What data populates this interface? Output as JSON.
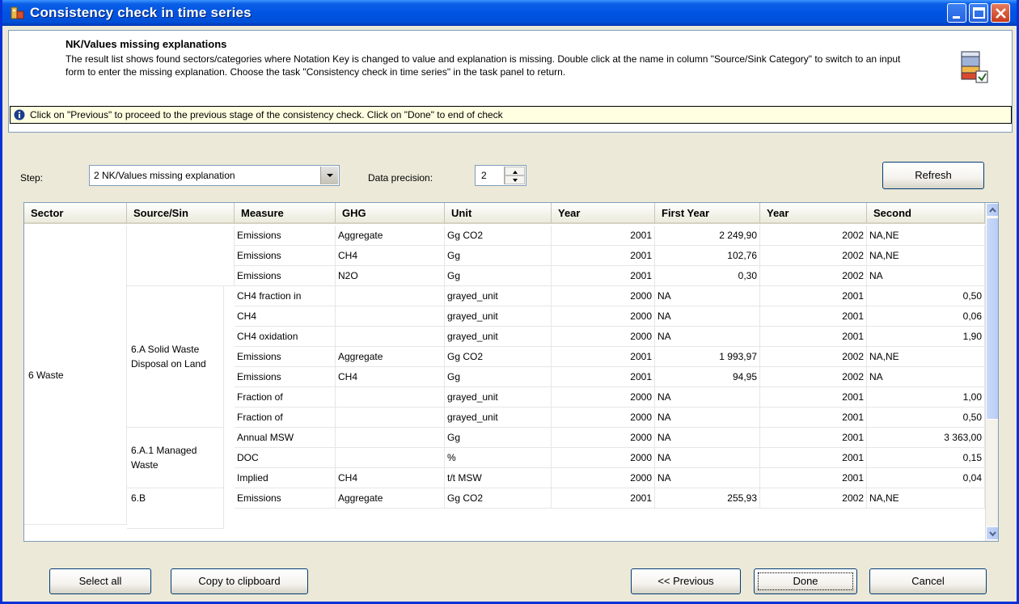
{
  "window": {
    "title": "Consistency check in time series"
  },
  "header": {
    "title": "NK/Values missing explanations",
    "description": "The result list shows found sectors/categories where Notation Key is changed to value and explanation is missing. Double click at the name in column \"Source/Sink Category\" to switch to an input form to enter the missing explanation. Choose the task \"Consistency check in time series\" in the task panel to return."
  },
  "info": {
    "text": "Click on \"Previous\" to proceed to the previous stage of the consistency check. Click on \"Done\" to end of check"
  },
  "toolbar": {
    "step_label": "Step:",
    "step_value": "2  NK/Values missing explanation",
    "precision_label": "Data precision:",
    "precision_value": "2",
    "refresh_label": "Refresh"
  },
  "grid": {
    "columns": [
      "Sector",
      "Source/Sin",
      "Measure",
      "GHG",
      "Unit",
      "Year",
      "First Year",
      "Year",
      "Second"
    ],
    "sector_cell": "6 Waste",
    "source_groups": [
      "6.A Solid Waste Disposal on Land",
      "6.A.1 Managed Waste",
      "6.B"
    ],
    "rows": [
      [
        "Emissions",
        "Aggregate",
        "Gg CO2",
        "2001",
        "2 249,90",
        "2002",
        "NA,NE"
      ],
      [
        "Emissions",
        "CH4",
        "Gg",
        "2001",
        "102,76",
        "2002",
        "NA,NE"
      ],
      [
        "Emissions",
        "N2O",
        "Gg",
        "2001",
        "0,30",
        "2002",
        "NA"
      ],
      [
        "CH4 fraction in",
        "",
        "grayed_unit",
        "2000",
        "NA",
        "2001",
        "0,50"
      ],
      [
        "CH4",
        "",
        "grayed_unit",
        "2000",
        "NA",
        "2001",
        "0,06"
      ],
      [
        "CH4 oxidation",
        "",
        "grayed_unit",
        "2000",
        "NA",
        "2001",
        "1,90"
      ],
      [
        "Emissions",
        "Aggregate",
        "Gg CO2",
        "2001",
        "1 993,97",
        "2002",
        "NA,NE"
      ],
      [
        "Emissions",
        "CH4",
        "Gg",
        "2001",
        "94,95",
        "2002",
        "NA"
      ],
      [
        "Fraction of",
        "",
        "grayed_unit",
        "2000",
        "NA",
        "2001",
        "1,00"
      ],
      [
        "Fraction of",
        "",
        "grayed_unit",
        "2000",
        "NA",
        "2001",
        "0,50"
      ],
      [
        "Annual MSW",
        "",
        "Gg",
        "2000",
        "NA",
        "2001",
        "3 363,00"
      ],
      [
        "DOC",
        "",
        "%",
        "2000",
        "NA",
        "2001",
        "0,15"
      ],
      [
        "Implied",
        "CH4",
        "t/t MSW",
        "2000",
        "NA",
        "2001",
        "0,04"
      ],
      [
        "Emissions",
        "Aggregate",
        "Gg CO2",
        "2001",
        "255,93",
        "2002",
        "NA,NE"
      ]
    ]
  },
  "buttons": {
    "select_all": "Select all",
    "copy": "Copy to clipboard",
    "previous": "<< Previous",
    "done": "Done",
    "cancel": "Cancel"
  },
  "icons": {
    "title_icon": "app-icon",
    "header_icon": "database-check-icon",
    "info_icon": "info-icon"
  },
  "colors": {
    "titlebar": "#0053e1",
    "info_bg": "#ffffe1",
    "window_bg": "#ece9d8"
  }
}
